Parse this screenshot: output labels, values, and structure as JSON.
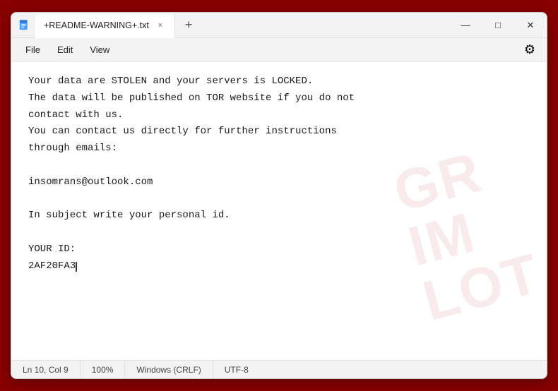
{
  "window": {
    "title": "+README-WARNING+.txt",
    "app_icon": "notepad",
    "tab_label": "+README-WARNING+.txt",
    "close_tab_label": "×",
    "new_tab_label": "+",
    "minimize_label": "—",
    "maximize_label": "□",
    "close_label": "✕"
  },
  "menu": {
    "file_label": "File",
    "edit_label": "Edit",
    "view_label": "View",
    "gear_icon": "⚙"
  },
  "content": {
    "text": "Your data are STOLEN and your servers is LOCKED.\nThe data will be published on TOR website if you do not\ncontact with us.\nYou can contact us directly for further instructions\nthrough emails:\n\ninsomrans@outlook.com\n\nIn subject write your personal id.\n\nYOUR ID:\n2AF20FA3"
  },
  "watermark": {
    "line1": "GR",
    "line2": "IM",
    "line3": "LOT"
  },
  "status_bar": {
    "position": "Ln 10, Col 9",
    "zoom": "100%",
    "line_ending": "Windows (CRLF)",
    "encoding": "UTF-8"
  }
}
